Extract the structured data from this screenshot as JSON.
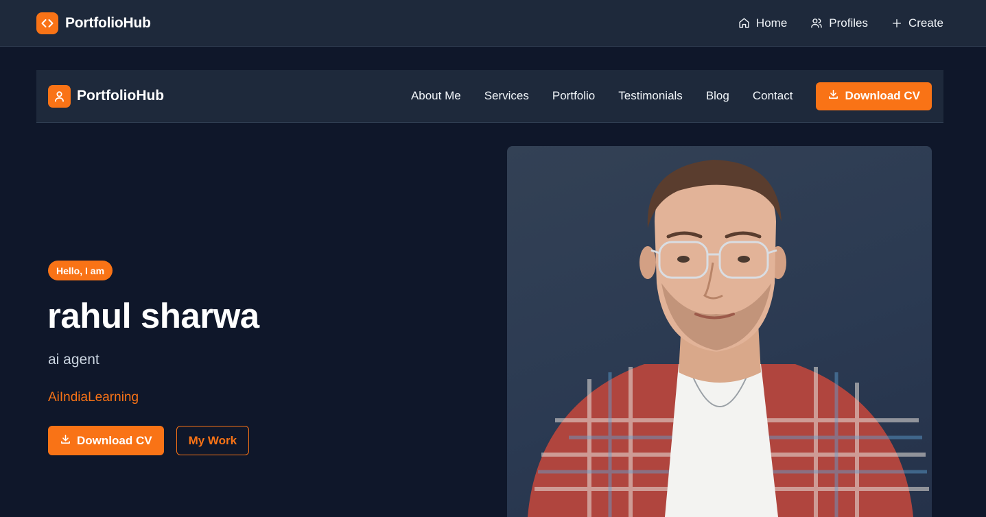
{
  "appbar": {
    "brand": "PortfolioHub",
    "brand_icon": "code-icon",
    "nav": [
      {
        "label": "Home",
        "icon": "home-icon"
      },
      {
        "label": "Profiles",
        "icon": "users-icon"
      },
      {
        "label": "Create",
        "icon": "plus-icon"
      }
    ]
  },
  "portfolio_nav": {
    "brand": "PortfolioHub",
    "brand_icon": "user-icon",
    "links": [
      "About Me",
      "Services",
      "Portfolio",
      "Testimonials",
      "Blog",
      "Contact"
    ],
    "cta_label": "Download CV",
    "cta_icon": "download-icon"
  },
  "hero": {
    "badge": "Hello, I am",
    "name": "rahul sharwa",
    "role": "ai agent",
    "organization": "AiIndiaLearning",
    "primary_button": "Download CV",
    "secondary_button": "My Work"
  },
  "photo": {
    "subject": "portrait-photo"
  },
  "colors": {
    "background": "#0f172a",
    "surface": "#1e293b",
    "accent": "#f97316"
  }
}
